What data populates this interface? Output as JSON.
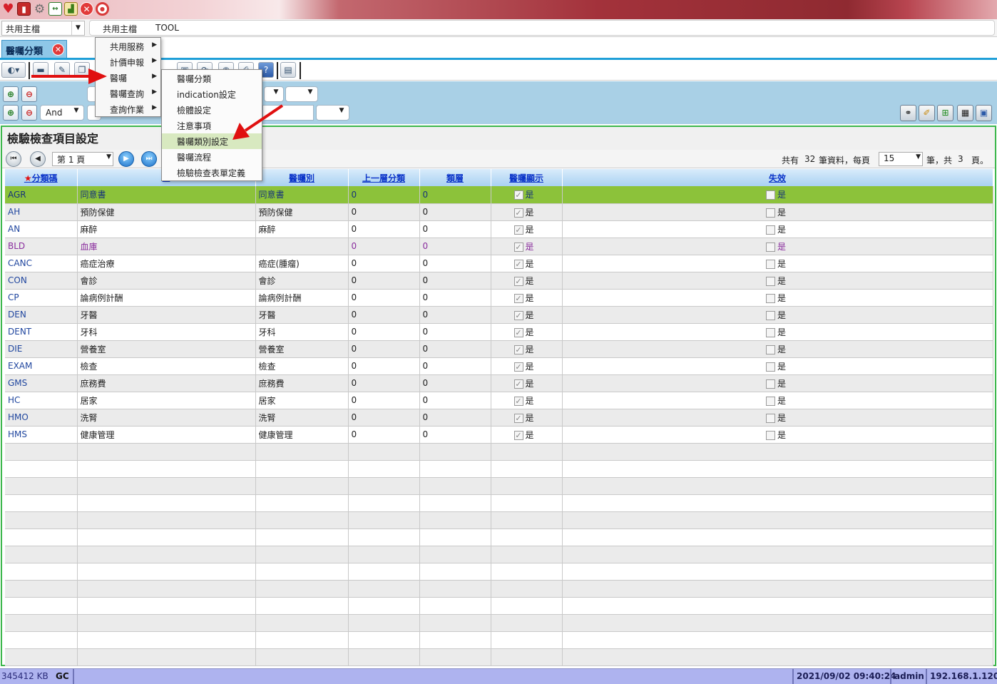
{
  "menubar": {
    "module_select": "共用主檔",
    "items": [
      "共用主檔",
      "TOOL"
    ]
  },
  "tab": {
    "label": "醫囑分類"
  },
  "search": {
    "logic_select": "And"
  },
  "panel": {
    "title": "檢驗檢查項目設定"
  },
  "pager": {
    "page_select": "第 1 頁",
    "total_prefix": "共有",
    "total_records": "32",
    "records_label": "筆資料，每頁",
    "per_page": "15",
    "pages_prefix": "筆，共",
    "total_pages": "3",
    "pages_suffix": "頁。"
  },
  "grid": {
    "columns": [
      "分類碼",
      "",
      "醫囑別",
      "上一層分類",
      "類層",
      "醫囑顯示",
      "失效"
    ],
    "rows": [
      {
        "code": "AGR",
        "name": "同意書",
        "type": "同意書",
        "parent": "0",
        "level": "0",
        "display": "是",
        "invalid": "是"
      },
      {
        "code": "AH",
        "name": "預防保健",
        "type": "預防保健",
        "parent": "0",
        "level": "0",
        "display": "是",
        "invalid": "是"
      },
      {
        "code": "AN",
        "name": "麻醉",
        "type": "麻醉",
        "parent": "0",
        "level": "0",
        "display": "是",
        "invalid": "是"
      },
      {
        "code": "BLD",
        "name": "血庫",
        "type": "",
        "parent": "0",
        "level": "0",
        "display": "是",
        "invalid": "是"
      },
      {
        "code": "CANC",
        "name": "癌症治療",
        "type": "癌症(腫瘤)",
        "parent": "0",
        "level": "0",
        "display": "是",
        "invalid": "是"
      },
      {
        "code": "CON",
        "name": "會診",
        "type": "會診",
        "parent": "0",
        "level": "0",
        "display": "是",
        "invalid": "是"
      },
      {
        "code": "CP",
        "name": "論病例計酬",
        "type": "論病例計酬",
        "parent": "0",
        "level": "0",
        "display": "是",
        "invalid": "是"
      },
      {
        "code": "DEN",
        "name": "牙醫",
        "type": "牙醫",
        "parent": "0",
        "level": "0",
        "display": "是",
        "invalid": "是"
      },
      {
        "code": "DENT",
        "name": "牙科",
        "type": "牙科",
        "parent": "0",
        "level": "0",
        "display": "是",
        "invalid": "是"
      },
      {
        "code": "DIE",
        "name": "營養室",
        "type": "營養室",
        "parent": "0",
        "level": "0",
        "display": "是",
        "invalid": "是"
      },
      {
        "code": "EXAM",
        "name": "檢查",
        "type": "檢查",
        "parent": "0",
        "level": "0",
        "display": "是",
        "invalid": "是"
      },
      {
        "code": "GMS",
        "name": "庶務費",
        "type": "庶務費",
        "parent": "0",
        "level": "0",
        "display": "是",
        "invalid": "是"
      },
      {
        "code": "HC",
        "name": "居家",
        "type": "居家",
        "parent": "0",
        "level": "0",
        "display": "是",
        "invalid": "是"
      },
      {
        "code": "HMO",
        "name": "洗腎",
        "type": "洗腎",
        "parent": "0",
        "level": "0",
        "display": "是",
        "invalid": "是"
      },
      {
        "code": "HMS",
        "name": "健康管理",
        "type": "健康管理",
        "parent": "0",
        "level": "0",
        "display": "是",
        "invalid": "是"
      }
    ]
  },
  "menu_level1": [
    "共用服務",
    "計價申報",
    "醫囑",
    "醫囑查詢",
    "查詢作業"
  ],
  "menu_level2": [
    "醫囑分類",
    "indication設定",
    "檢體設定",
    "注意事項",
    "醫囑類別設定",
    "醫囑流程",
    "檢驗檢查表單定義"
  ],
  "status": {
    "memory": "345412 KB",
    "gc": "GC",
    "datetime": "2021/09/02 09:40:24",
    "user": "admin",
    "ip": "192.168.1.120"
  },
  "colors": {
    "selected_row": "#8cc23a",
    "panel_border": "#3cb74c",
    "search_bg": "#a9d0e6",
    "statusbar": "#aeb3ef",
    "annotation_arrow": "#e01010"
  },
  "icons": {
    "titlebar": [
      "heart-icon",
      "book-icon",
      "gear-icon",
      "resize-icon",
      "chart-icon",
      "close-icon",
      "lifebuoy-icon"
    ]
  }
}
